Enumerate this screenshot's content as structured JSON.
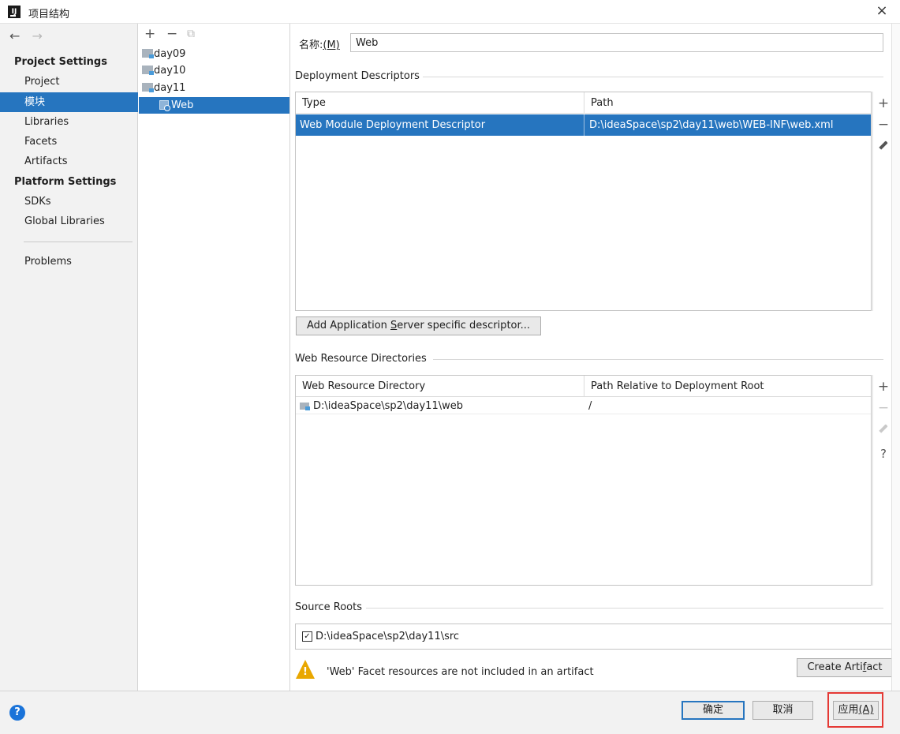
{
  "window": {
    "title": "项目结构",
    "close_symbol": "×"
  },
  "sidebar": {
    "back_symbol": "←",
    "forward_symbol": "→",
    "project_settings_heading": "Project Settings",
    "project_items": [
      {
        "label": "Project",
        "selected": false
      },
      {
        "label": "模块",
        "selected": true
      },
      {
        "label": "Libraries",
        "selected": false
      },
      {
        "label": "Facets",
        "selected": false
      },
      {
        "label": "Artifacts",
        "selected": false
      }
    ],
    "platform_settings_heading": "Platform Settings",
    "platform_items": [
      {
        "label": "SDKs"
      },
      {
        "label": "Global Libraries"
      }
    ],
    "problems_label": "Problems"
  },
  "tree": {
    "add_symbol": "+",
    "remove_symbol": "−",
    "copy_symbol": "⧉",
    "modules": [
      {
        "label": "day09"
      },
      {
        "label": "day10"
      },
      {
        "label": "day11"
      }
    ],
    "facet": {
      "label": "Web",
      "selected": true
    }
  },
  "content": {
    "name_label": "名称:",
    "name_mnemonic": "(M)",
    "name_value": "Web",
    "deployment": {
      "title": "Deployment Descriptors",
      "columns": [
        "Type",
        "Path"
      ],
      "rows": [
        {
          "type": "Web Module Deployment Descriptor",
          "path": "D:\\ideaSpace\\sp2\\day11\\web\\WEB-INF\\web.xml"
        }
      ],
      "add_descriptor_prefix": "Add Application ",
      "add_descriptor_mnemonic": "S",
      "add_descriptor_suffix": "erver specific descriptor..."
    },
    "web_resources": {
      "title": "Web Resource Directories",
      "columns": [
        "Web Resource Directory",
        "Path Relative to Deployment Root"
      ],
      "rows": [
        {
          "directory": "D:\\ideaSpace\\sp2\\day11\\web",
          "relative_path": "/"
        }
      ],
      "help_symbol": "?"
    },
    "source_roots": {
      "title": "Source Roots",
      "items": [
        {
          "path": "D:\\ideaSpace\\sp2\\day11\\src",
          "checked": true
        }
      ]
    },
    "warning": {
      "text": "'Web' Facet resources are not included in an artifact",
      "create_artifact_prefix": "Create Arti",
      "create_artifact_mnemonic": "f",
      "create_artifact_suffix": "act"
    }
  },
  "footer": {
    "help_symbol": "?",
    "ok_label": "确定",
    "cancel_label": "取消",
    "apply_label": "应用",
    "apply_mnemonic": "(A)"
  },
  "colors": {
    "selection": "#2675bf",
    "warning": "#e9a700",
    "highlight": "#e53935",
    "help": "#1a73d9"
  }
}
